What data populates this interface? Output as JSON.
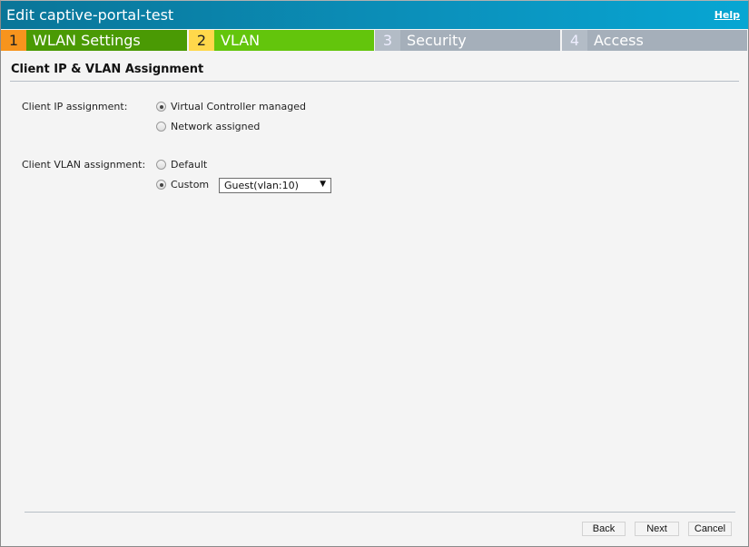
{
  "window": {
    "title": "Edit captive-portal-test",
    "help_label": "Help"
  },
  "steps": [
    {
      "number": "1",
      "label": "WLAN Settings",
      "state": "completed"
    },
    {
      "number": "2",
      "label": "VLAN",
      "state": "active"
    },
    {
      "number": "3",
      "label": "Security",
      "state": "pending"
    },
    {
      "number": "4",
      "label": "Access",
      "state": "pending"
    }
  ],
  "section": {
    "title": "Client IP & VLAN Assignment"
  },
  "client_ip": {
    "label": "Client IP assignment:",
    "options": [
      {
        "label": "Virtual Controller managed",
        "selected": true
      },
      {
        "label": "Network assigned",
        "selected": false
      }
    ]
  },
  "client_vlan": {
    "label": "Client VLAN assignment:",
    "options": [
      {
        "label": "Default",
        "selected": false
      },
      {
        "label": "Custom",
        "selected": true
      }
    ],
    "custom_select_value": "Guest(vlan:10)",
    "dropdown_arrow": "▼"
  },
  "footer": {
    "back_label": "Back",
    "next_label": "Next",
    "cancel_label": "Cancel"
  },
  "colors": {
    "titlebar": "#0b92bd",
    "step_completed": "#4a9a04",
    "step_active": "#63c50c",
    "step_pending": "#a5afba",
    "step1_number": "#f7941d",
    "step2_number": "#ffd84b"
  }
}
